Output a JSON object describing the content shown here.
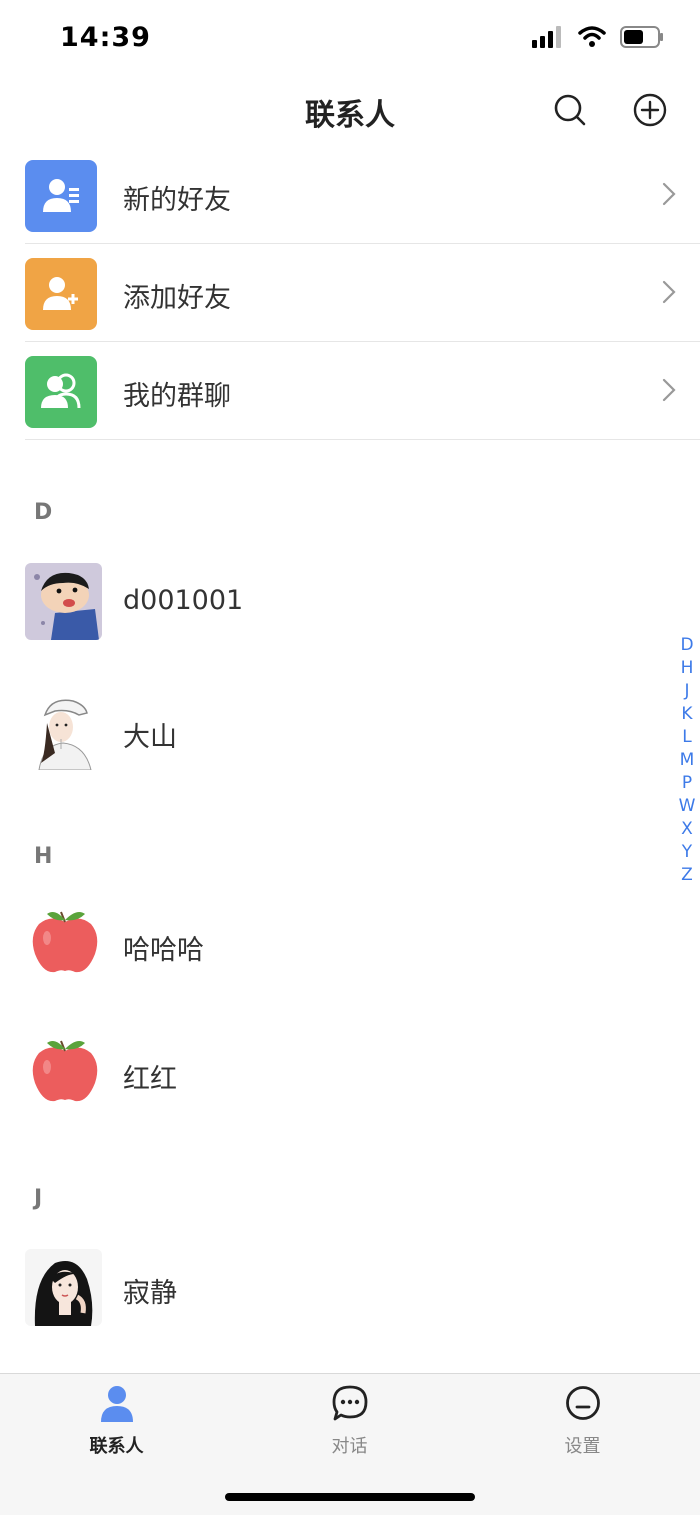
{
  "status": {
    "time": "14:39"
  },
  "nav": {
    "title": "联系人"
  },
  "menu": [
    {
      "label": "新的好友",
      "icon": "new-friend-icon",
      "color": "#5b8def"
    },
    {
      "label": "添加好友",
      "icon": "add-friend-icon",
      "color": "#f0a445"
    },
    {
      "label": "我的群聊",
      "icon": "group-chat-icon",
      "color": "#4fbe6a"
    }
  ],
  "sections": [
    {
      "letter": "D",
      "contacts": [
        {
          "name": "d001001",
          "avatar": "cartoon-boy"
        },
        {
          "name": "大山",
          "avatar": "girl-with-cap"
        }
      ]
    },
    {
      "letter": "H",
      "contacts": [
        {
          "name": "哈哈哈",
          "avatar": "apple"
        },
        {
          "name": "红红",
          "avatar": "apple"
        }
      ]
    },
    {
      "letter": "J",
      "contacts": [
        {
          "name": "寂静",
          "avatar": "girl-portrait"
        }
      ]
    }
  ],
  "index": [
    "D",
    "H",
    "J",
    "K",
    "L",
    "M",
    "P",
    "W",
    "X",
    "Y",
    "Z"
  ],
  "tabs": [
    {
      "label": "联系人",
      "icon": "contacts-icon",
      "active": true
    },
    {
      "label": "对话",
      "icon": "chat-icon",
      "active": false
    },
    {
      "label": "设置",
      "icon": "settings-icon",
      "active": false
    }
  ],
  "colors": {
    "accent": "#3d7ae8",
    "tab_active_icon": "#5b8def"
  }
}
